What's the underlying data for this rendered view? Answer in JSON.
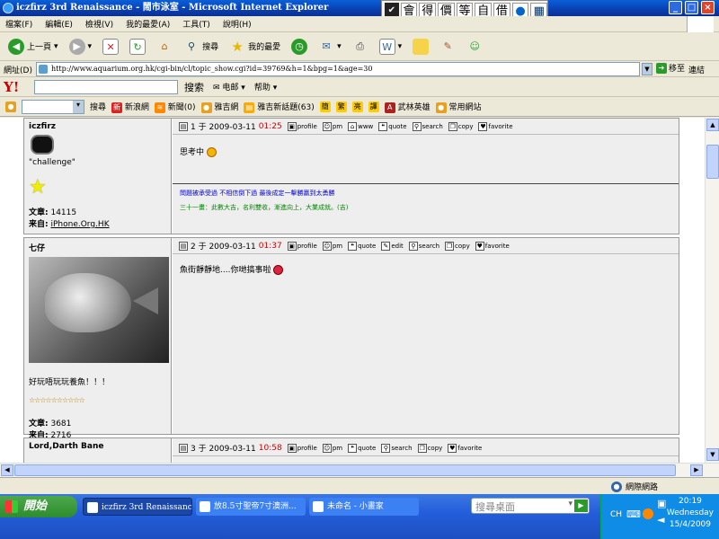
{
  "window": {
    "title": "iczfirz 3rd Renaissance - 鬧市泳室 - Microsoft Internet Explorer",
    "minimize": "_",
    "maximize": "□",
    "close": "×"
  },
  "ime": {
    "keys": [
      "會",
      "得",
      "價",
      "等",
      "自",
      "借"
    ]
  },
  "menu": {
    "items": [
      "檔案(F)",
      "編輯(E)",
      "檢視(V)",
      "我的最愛(A)",
      "工具(T)",
      "說明(H)"
    ]
  },
  "toolbar": {
    "back": "上一頁",
    "search": "搜尋",
    "favorites": "我的最愛"
  },
  "address": {
    "label": "網址(D)",
    "url": "http://www.aquarium.org.hk/cgi-bin/cl/topic_show.cgi?id=39769&h=1&bpg=1&age=30",
    "go": "移至",
    "links": "連結"
  },
  "yahoo": {
    "logo": "Y!",
    "search_button": "搜索",
    "mail": "电邮",
    "help": "帮助"
  },
  "linksbar": {
    "items": [
      "搜尋",
      "新浪網",
      "新聞(0)",
      "雅吉網",
      "雅吉新話題(63)",
      "簡",
      "繁",
      "亮",
      "譯",
      "武林英雄",
      "常用網站"
    ]
  },
  "posts": [
    {
      "username": "iczfirz",
      "title": "\"challenge\"",
      "posts_label": "文章:",
      "posts": "14115",
      "from_label": "来自:",
      "from": "iPhone.Org.HK",
      "header": "1 于 2009-03-11",
      "time": "01:25",
      "actions": [
        "profile",
        "pm",
        "www",
        "quote",
        "search",
        "copy",
        "favorite"
      ],
      "message": "思考中",
      "sig1": "問題被承受過 不相信倒下過 最後成定一擊勝贏到太勇勝",
      "sig2": "三十一畫：此數大吉，名利雙收，漸進向上，大業成就。(吉)"
    },
    {
      "username": "七仔",
      "title": "好玩唔玩玩養魚！！！",
      "stars": "☆☆☆☆☆☆☆☆☆☆",
      "posts_label": "文章:",
      "posts": "3681",
      "from_label": "来自:",
      "from": "2716",
      "header": "2 于 2009-03-11",
      "time": "01:37",
      "actions": [
        "profile",
        "pm",
        "quote",
        "edit",
        "search",
        "copy",
        "favorite"
      ],
      "message": "魚街靜靜地....你哋搞事啦"
    },
    {
      "username": "Lord,Darth Bane",
      "header": "3 于 2009-03-11",
      "time": "10:58",
      "actions": [
        "profile",
        "pm",
        "quote",
        "search",
        "copy",
        "favorite"
      ]
    }
  ],
  "status": {
    "zone": "網際網路"
  },
  "taskbar": {
    "start": "開始",
    "tasks": [
      "iczfirz 3rd Renaissance...",
      "放8.5寸聖帝7寸澳洲...",
      "未命名 - 小畫家"
    ],
    "search_placeholder": "搜尋桌面",
    "lang": "CH",
    "time": "20:19",
    "day": "Wednesday",
    "date": "15/4/2009"
  }
}
